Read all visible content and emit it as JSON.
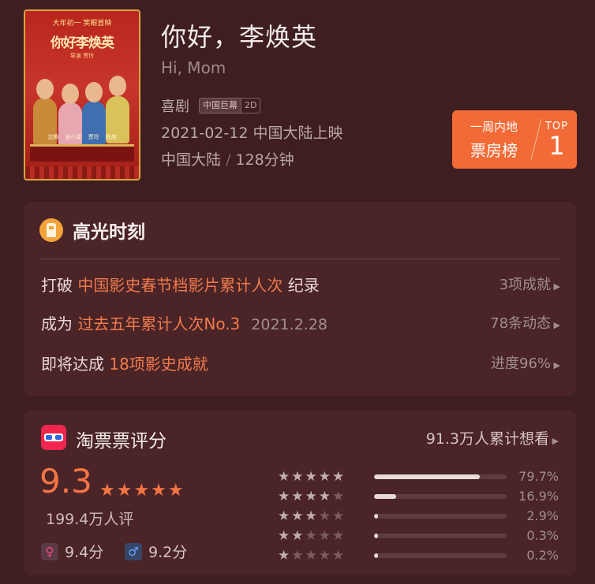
{
  "movie": {
    "title": "你好，李焕英",
    "en_title": "Hi, Mom",
    "genre": "喜剧",
    "badges": [
      "中国巨幕",
      "2D"
    ],
    "release": "2021-02-12 中国大陆上映",
    "region": "中国大陆",
    "duration": "128分钟",
    "poster": {
      "tagline": "大年初一 笑眼首映",
      "title": "你好李焕英",
      "subtitle": "导演 贾玲",
      "cast": "沈腾 张小斐 贾玲 陈赫"
    }
  },
  "rank": {
    "line1": "一周内地",
    "line2": "票房榜",
    "top_label": "TOP",
    "number": "1",
    "color": "#f26a36"
  },
  "highlights": {
    "title": "高光时刻",
    "icon": "tower-icon",
    "rows": [
      {
        "prefix": "打破 ",
        "accent": "中国影史春节档影片累计人次",
        "suffix": " 纪录",
        "date": "",
        "more": "3项成就"
      },
      {
        "prefix": "成为 ",
        "accent": "过去五年累计人次No.3",
        "suffix": "",
        "date": "2021.2.28",
        "more": "78条动态"
      },
      {
        "prefix": "即将达成 ",
        "accent": "18项影史成就",
        "suffix": "",
        "date": "",
        "more": "进度96%"
      }
    ]
  },
  "rating": {
    "source": "淘票票评分",
    "want_count": "91.3万人累计想看",
    "score": "9.3",
    "star_rating": 5,
    "count": "199.4万人评",
    "female_icon": "female-icon",
    "female_score": "9.4分",
    "male_icon": "male-icon",
    "male_score": "9.2分",
    "accent_color": "#f37545",
    "distribution": [
      {
        "stars": 5,
        "percent": "79.7%",
        "value": 79.7
      },
      {
        "stars": 4,
        "percent": "16.9%",
        "value": 16.9
      },
      {
        "stars": 3,
        "percent": "2.9%",
        "value": 2.9
      },
      {
        "stars": 2,
        "percent": "0.3%",
        "value": 0.3
      },
      {
        "stars": 1,
        "percent": "0.2%",
        "value": 0.2
      }
    ]
  }
}
